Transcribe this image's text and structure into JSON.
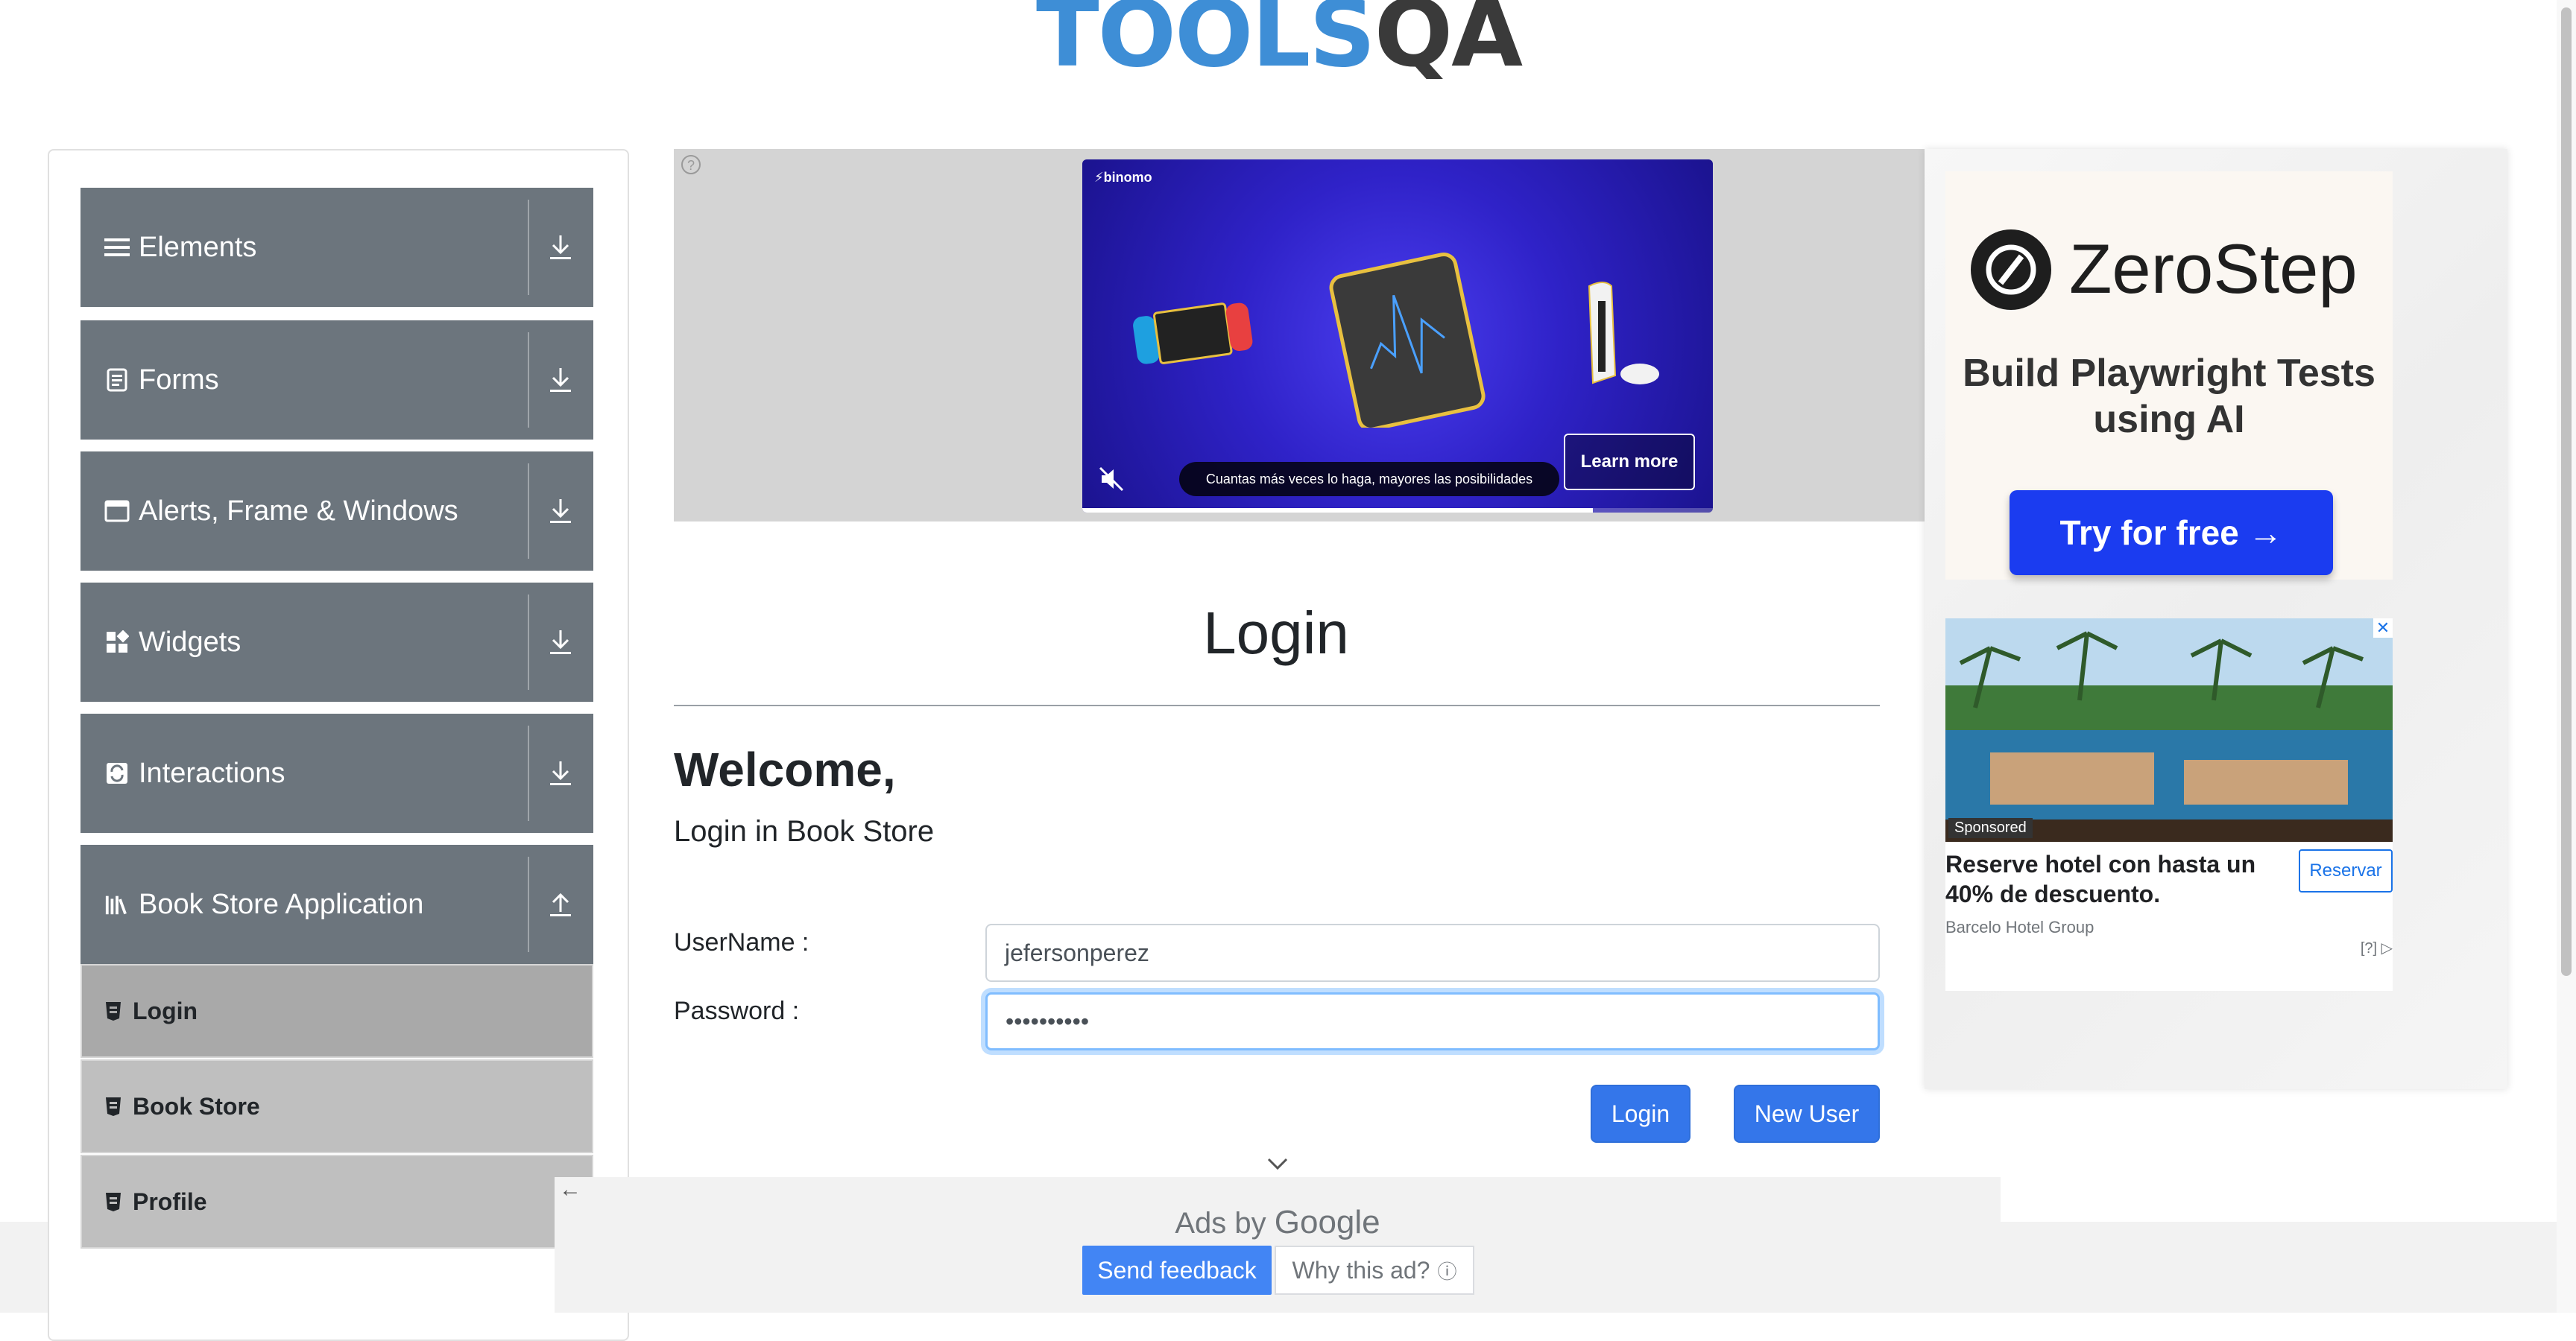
{
  "header": {
    "logo_part1": "TOOLS",
    "logo_part2": "QA"
  },
  "sidebar": {
    "groups": [
      {
        "label": "Elements",
        "icon": "list-icon",
        "toggle": "download-icon"
      },
      {
        "label": "Forms",
        "icon": "form-icon",
        "toggle": "download-icon"
      },
      {
        "label": "Alerts, Frame & Windows",
        "icon": "window-icon",
        "toggle": "download-icon"
      },
      {
        "label": "Widgets",
        "icon": "widgets-icon",
        "toggle": "download-icon"
      },
      {
        "label": "Interactions",
        "icon": "interactions-icon",
        "toggle": "download-icon"
      },
      {
        "label": "Book Store Application",
        "icon": "books-icon",
        "toggle": "upload-icon"
      }
    ],
    "bookstore_items": [
      {
        "label": "Login",
        "active": true
      },
      {
        "label": "Book Store",
        "active": false
      },
      {
        "label": "Profile",
        "active": false
      }
    ]
  },
  "top_ad": {
    "brand": "binomo",
    "caption": "Cuantas más veces lo haga, mayores las posibilidades",
    "cta": "Learn more",
    "info": "?",
    "progress_fraction": 0.81
  },
  "main": {
    "title": "Login",
    "welcome": "Welcome,",
    "subtitle": "Login in Book Store",
    "username_label": "UserName :",
    "username_value": "jefersonperez",
    "password_label": "Password :",
    "password_value": "••••••••••",
    "login_button": "Login",
    "new_user_button": "New User"
  },
  "right_ad": {
    "zerostep": {
      "name": "ZeroStep",
      "tagline": "Build Playwright Tests using AI",
      "cta": "Try for free →"
    },
    "hotel": {
      "sponsored": "Sponsored",
      "title": "Reserve hotel con hasta un 40% de descuento.",
      "brand": "Barcelo Hotel Group",
      "cta": "Reservar",
      "adchoices": "[?]"
    }
  },
  "bottom_ad": {
    "ads_by": "Ads by",
    "google": "Google",
    "send_feedback": "Send feedback",
    "why_this_ad": "Why this ad?"
  },
  "colors": {
    "sidebar_header_bg": "#6c757d",
    "sub_item_bg": "#bfbfbf",
    "primary_button": "#3476ea",
    "zerostep_cta": "#1b3cf0",
    "ad_bg": "#2f22c8"
  }
}
